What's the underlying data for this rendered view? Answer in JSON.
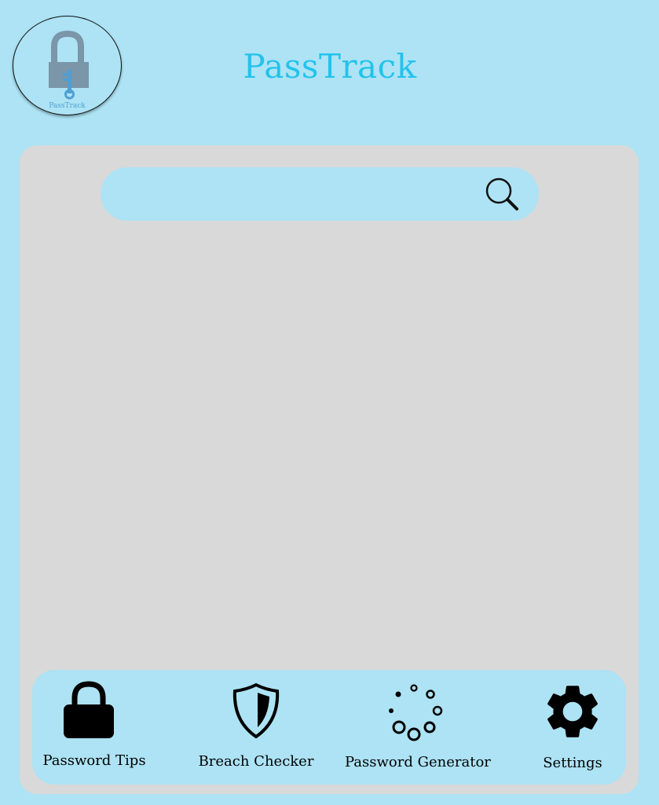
{
  "header": {
    "logo_text": "PassTrack",
    "title": "PassTrack"
  },
  "search": {
    "placeholder": "",
    "value": "",
    "icon": "search-icon"
  },
  "nav": {
    "items": [
      {
        "label": "Password Tips",
        "icon": "lock-icon"
      },
      {
        "label": "Breach Checker",
        "icon": "shield-icon"
      },
      {
        "label": "Password Generator",
        "icon": "loading-dots-icon"
      },
      {
        "label": "Settings",
        "icon": "gear-icon"
      }
    ]
  },
  "colors": {
    "background": "#ADE3F4",
    "panel": "#D9D9D9",
    "title": "#23C3EC",
    "logo_lock": "#7A96A8",
    "logo_key": "#4F9FD4"
  }
}
